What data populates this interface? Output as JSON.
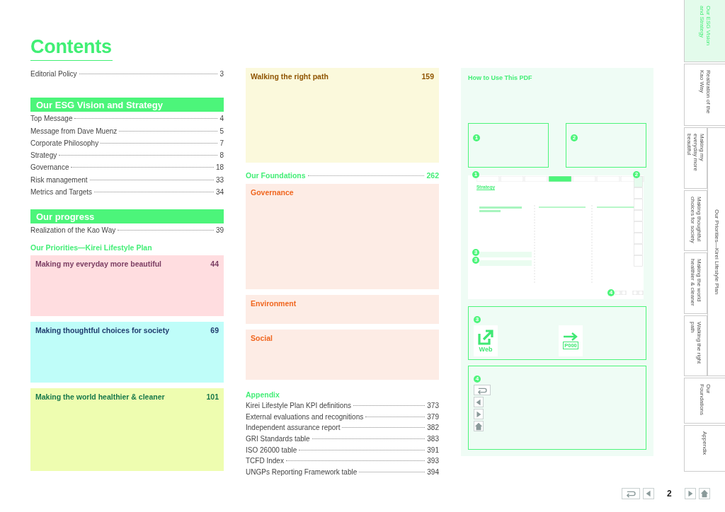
{
  "title": "Contents",
  "editorial": {
    "label": "Editorial Policy",
    "page": "3"
  },
  "left_sections": [
    {
      "heading": "Our ESG Vision and Strategy",
      "entries": [
        {
          "label": "Top Message",
          "page": "4"
        },
        {
          "label": "Message from Dave Muenz",
          "page": "5"
        },
        {
          "label": "Corporate Philosophy",
          "page": "7"
        },
        {
          "label": "Strategy",
          "page": "8"
        },
        {
          "label": "Governance",
          "page": "18"
        },
        {
          "label": "Risk management",
          "page": "33"
        },
        {
          "label": "Metrics and Targets",
          "page": "34"
        }
      ]
    },
    {
      "heading": "Our progress",
      "entries": [
        {
          "label": "Realization of the Kao Way",
          "page": "39"
        }
      ]
    }
  ],
  "priorities": {
    "heading": "Our Priorities—Kirei Lifestyle Plan",
    "cards": [
      {
        "title": {
          "label": "Making my everyday more beautiful",
          "color": "#7a3d62"
        },
        "page": "44",
        "color": "#ffdde0"
      },
      {
        "title": {
          "label": "Making thoughtful choices for society",
          "color": "#1f3c6e"
        },
        "page": "69",
        "color": "#bffdf9"
      },
      {
        "title": {
          "label": "Making the world healthier & cleaner",
          "color": "#17784a"
        },
        "page": "101",
        "color": "#eefdb0"
      }
    ]
  },
  "walking_card": {
    "title": {
      "label": "Walking the right path",
      "color": "#8f5400"
    },
    "page": "159",
    "color": "#fbf9dc"
  },
  "foundations": {
    "label": "Our Foundations",
    "page": "262",
    "cards": [
      {
        "label": "Governance"
      },
      {
        "label": "Environment"
      },
      {
        "label": "Social"
      }
    ]
  },
  "appendix": {
    "heading": "Appendix",
    "entries": [
      {
        "label": "Kirei Lifestyle Plan KPI definitions",
        "page": "373"
      },
      {
        "label": "External evaluations and recognitions",
        "page": "379"
      },
      {
        "label": "Independent assurance report",
        "page": "382"
      },
      {
        "label": "GRI Standards table",
        "page": "383"
      },
      {
        "label": "ISO 26000 table",
        "page": "391"
      },
      {
        "label": "TCFD Index",
        "page": "393"
      },
      {
        "label": "UNGPs Reporting Framework table",
        "page": "394"
      }
    ]
  },
  "how_to": {
    "title": "How to Use This PDF",
    "callouts": [
      "1",
      "2"
    ],
    "preview": {
      "heading": "Strategy",
      "markers": [
        "1",
        "2",
        "3",
        "3",
        "4"
      ]
    },
    "link_box": {
      "number": "3",
      "web_label": "Web",
      "page_label": "P000"
    },
    "nav_box": {
      "number": "4"
    }
  },
  "side_tabs": [
    {
      "kind": "tab",
      "label": "Our ESG Vision and Strategy",
      "selected": true
    },
    {
      "kind": "tab",
      "label": "Realization of the Kao Way",
      "selected": false
    },
    {
      "kind": "group",
      "label": "Our Priorities—Kirei Lifestyle Plan",
      "children": [
        {
          "label": "Making my everyday more beautiful",
          "selected": false
        },
        {
          "label": "Making thoughtful choices for society",
          "selected": false
        },
        {
          "label": "Making the world healthier & cleaner",
          "selected": false
        },
        {
          "label": "Walking the right path",
          "selected": false
        }
      ]
    },
    {
      "kind": "tab",
      "label": "Our Foundations",
      "selected": false
    },
    {
      "kind": "tab",
      "label": "Appendix",
      "selected": false
    }
  ],
  "footer": {
    "page": "2"
  }
}
